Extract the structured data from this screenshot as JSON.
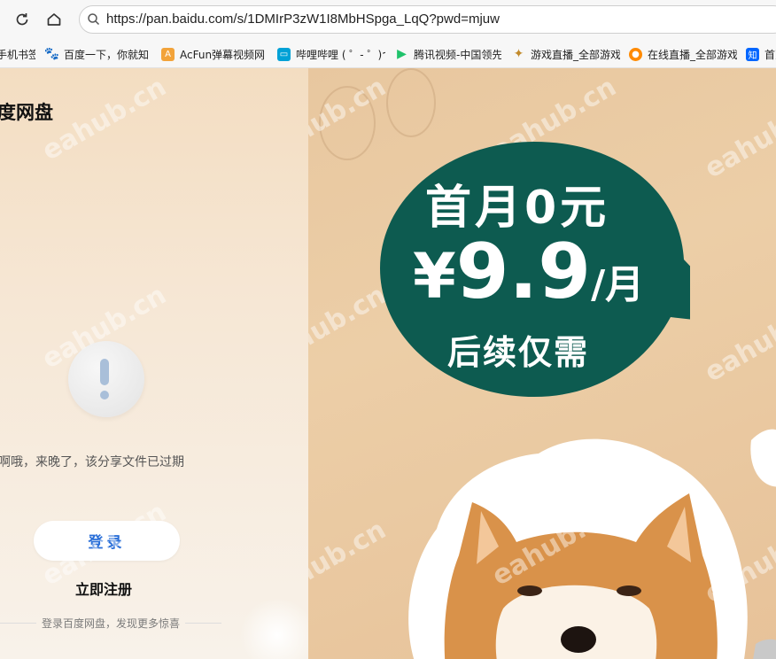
{
  "browser": {
    "url": "https://pan.baidu.com/s/1DMIrP3zW1I8MbHSpga_LqQ?pwd=mjuw",
    "bookmarks": [
      {
        "label": "手机书签",
        "icon": "bookmark-folder-icon",
        "color": "#ffffff"
      },
      {
        "label": "百度一下，你就知",
        "icon": "baidu-paw-icon",
        "color": "#2932e1"
      },
      {
        "label": "AcFun弹幕视频网",
        "icon": "acfun-icon",
        "color": "#fd4c5d"
      },
      {
        "label": "哔哩哔哩 ( ゜- ゜)つ",
        "icon": "bilibili-icon",
        "color": "#00a1d6"
      },
      {
        "label": "腾讯视频-中国领先",
        "icon": "tencent-video-icon",
        "color": "#20c26b"
      },
      {
        "label": "游戏直播_全部游戏",
        "icon": "huya-icon",
        "color": "#ffa200"
      },
      {
        "label": "在线直播_全部游戏",
        "icon": "douyu-icon",
        "color": "#ff7700"
      },
      {
        "label": "首页",
        "icon": "zhihu-icon",
        "color": "#0066ff"
      }
    ]
  },
  "page": {
    "brand": "度网盘",
    "expired_message": "啊哦，来晚了，该分享文件已过期",
    "login_button": "登录",
    "register_link": "立即注册",
    "footer_note": "登录百度网盘，发现更多惊喜"
  },
  "promo": {
    "line1": "首月0元",
    "price_symbol": "¥",
    "price_value": "9.9",
    "price_unit": "/月",
    "line3": "后续仅需",
    "bubble_color": "#0d5b50"
  },
  "watermark": "eahub.cn"
}
